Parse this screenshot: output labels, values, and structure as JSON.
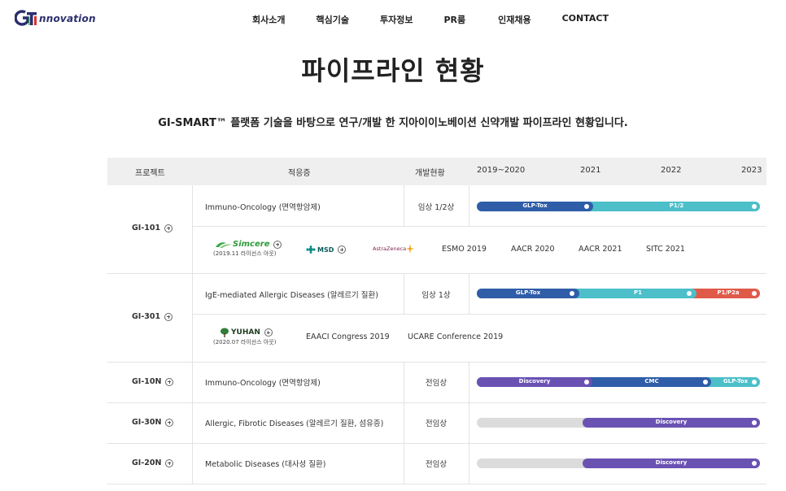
{
  "header": {
    "logo_text": "nnovation",
    "nav": [
      "회사소개",
      "핵심기술",
      "투자정보",
      "PR룸",
      "인재채용",
      "CONTACT"
    ]
  },
  "page": {
    "title": "파이프라인 현황",
    "subtitle": "GI-SMART™ 플랫폼 기술을 바탕으로 연구/개발 한 지아이이노베이션 신약개발 파이프라인 현황입니다."
  },
  "table": {
    "headers": {
      "project": "프로젝트",
      "indication": "적응증",
      "status": "개발현황",
      "y1": "2019~2020",
      "y2": "2021",
      "y3": "2022",
      "y4": "2023"
    },
    "rows": [
      {
        "project": "GI-101",
        "indication": "Immuno-Oncology (면역항암제)",
        "status": "임상 1/2상",
        "segments": [
          "GLP-Tox",
          "P1/2"
        ],
        "partners": [
          "Simcere",
          "MSD",
          "AstraZeneca"
        ],
        "license_note": "(2019.11 라이선스 아웃)",
        "events": [
          "ESMO 2019",
          "AACR 2020",
          "AACR 2021",
          "SITC 2021"
        ]
      },
      {
        "project": "GI-301",
        "indication": "IgE-mediated Allergic Diseases (알레르기 질환)",
        "status": "임상 1상",
        "segments": [
          "GLP-Tox",
          "P1",
          "P1/P2a"
        ],
        "partners": [
          "YUHAN"
        ],
        "license_note": "(2020.07 라이선스 아웃)",
        "events": [
          "EAACI Congress 2019",
          "UCARE Conference 2019"
        ]
      },
      {
        "project": "GI-10N",
        "indication": "Immuno-Oncology (면역항암제)",
        "status": "전임상",
        "segments": [
          "Discovery",
          "CMC",
          "GLP-Tox"
        ]
      },
      {
        "project": "GI-30N",
        "indication": "Allergic, Fibrotic Diseases (알레르기 질환, 섬유증)",
        "status": "전임상",
        "segments": [
          "Discovery"
        ]
      },
      {
        "project": "GI-20N",
        "indication": "Metabolic Diseases (대사성 질환)",
        "status": "전임상",
        "segments": [
          "Discovery"
        ]
      }
    ]
  },
  "colors": {
    "navy": "#2f5da8",
    "teal": "#4cbfc9",
    "red": "#e05a49",
    "purple": "#6a52b3",
    "grey": "#dcdcdc"
  }
}
